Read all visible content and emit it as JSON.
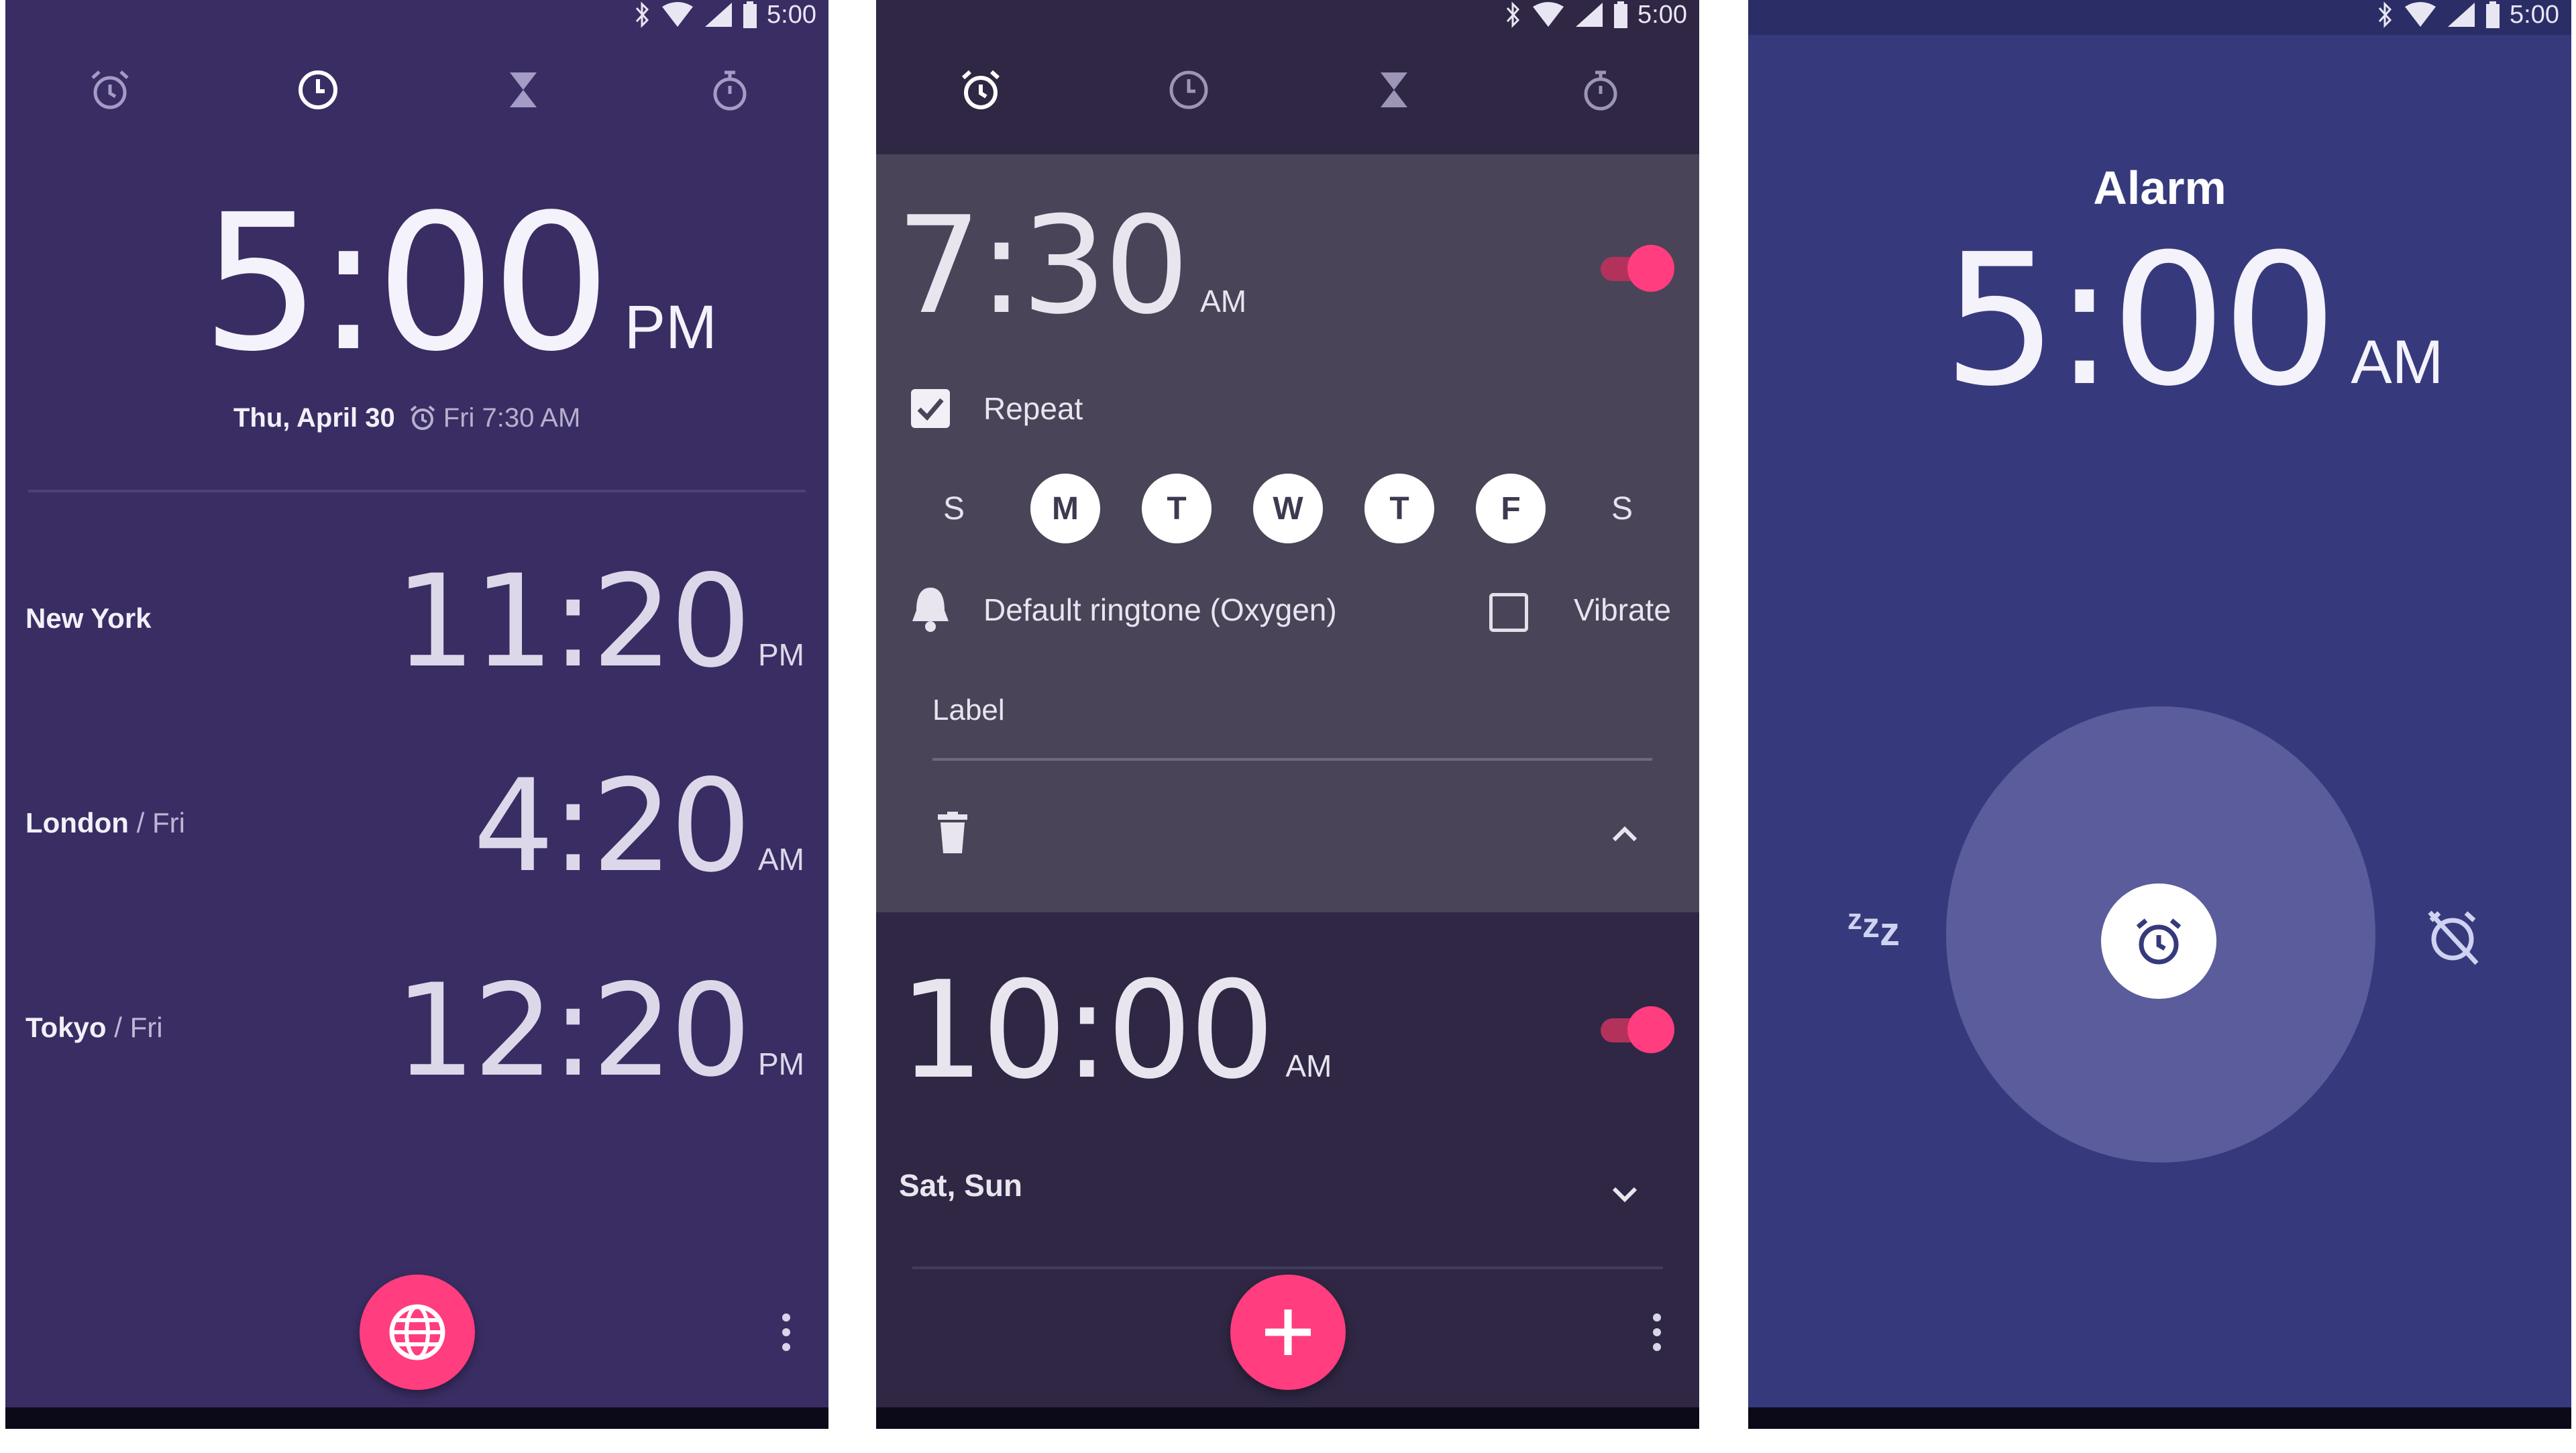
{
  "status_bar": {
    "time": "5:00"
  },
  "tabs": [
    "alarm-tab",
    "clock-tab",
    "timer-tab",
    "stopwatch-tab"
  ],
  "clock_screen": {
    "time": "5:00",
    "ampm": "PM",
    "date": "Thu, April 30",
    "next_alarm": "Fri 7:30 AM",
    "cities": [
      {
        "name": "New York",
        "day": "",
        "time": "11:20",
        "ampm": "PM"
      },
      {
        "name": "London",
        "day": " / Fri",
        "time": "4:20",
        "ampm": "AM"
      },
      {
        "name": "Tokyo",
        "day": " / Fri",
        "time": "12:20",
        "ampm": "PM"
      }
    ]
  },
  "alarm_screen": {
    "alarm1": {
      "time": "7:30",
      "ampm": "AM",
      "enabled": true,
      "repeat_label": "Repeat",
      "repeat_checked": true,
      "days": [
        {
          "label": "S",
          "on": false
        },
        {
          "label": "M",
          "on": true
        },
        {
          "label": "T",
          "on": true
        },
        {
          "label": "W",
          "on": true
        },
        {
          "label": "T",
          "on": true
        },
        {
          "label": "F",
          "on": true
        },
        {
          "label": "S",
          "on": false
        }
      ],
      "ringtone": "Default ringtone (Oxygen)",
      "vibrate_label": "Vibrate",
      "vibrate_checked": false,
      "label_placeholder": "Label"
    },
    "alarm2": {
      "time": "10:00",
      "ampm": "AM",
      "enabled": true,
      "days_summary": "Sat, Sun"
    }
  },
  "ringing_screen": {
    "title": "Alarm",
    "time": "5:00",
    "ampm": "AM"
  },
  "colors": {
    "accent": "#ff3d7f",
    "clock_bg": "#3a2d63",
    "alarm_bg": "#2f2744",
    "ringing_bg": "#363a7c"
  }
}
